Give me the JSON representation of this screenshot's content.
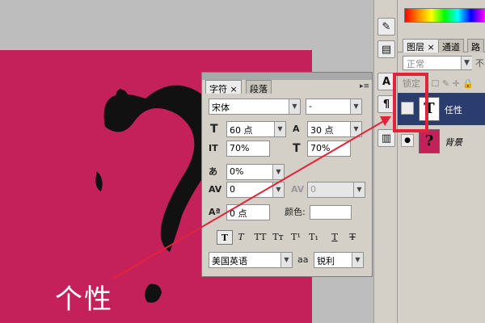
{
  "canvas": {
    "text": "个性",
    "background": "#c4215a"
  },
  "layers_panel": {
    "tabs": [
      "图层",
      "×",
      "通道",
      "路"
    ],
    "blend_mode": "正常",
    "opacity_label": "不",
    "lock_label": "锁定",
    "layers": [
      {
        "name": "任性",
        "thumb": "T",
        "selected": true
      },
      {
        "name": "背景",
        "thumb": "?",
        "selected": false
      }
    ]
  },
  "character_panel": {
    "tabs": [
      "字符",
      "×",
      "段落"
    ],
    "font_family": "宋体",
    "font_style": "-",
    "font_size": "60 点",
    "leading": "30 点",
    "vertical_scale": "70%",
    "horizontal_scale": "70%",
    "tsume": "0%",
    "kerning": "0",
    "tracking": "0",
    "baseline_shift": "0 点",
    "color_label": "颜色:",
    "language": "美国英语",
    "antialias": "锐利",
    "antialias_label": "aa",
    "icon_labels": {
      "size": "T",
      "leading": "A",
      "vscale": "IT",
      "hscale": "T",
      "tsume": "あ",
      "kerning": "AV",
      "tracking": "AV",
      "baseline": "Aª"
    },
    "style_buttons": [
      "T",
      "T",
      "TT",
      "Tт",
      "T¹",
      "T₁",
      "T",
      "T"
    ]
  },
  "toolstrip": {
    "buttons": [
      "✎",
      "▤",
      "A",
      "¶",
      "▥"
    ]
  },
  "colors": {
    "accent_red": "#e0243a",
    "canvas_pink": "#c4215a",
    "selected_layer": "#2b3c6f"
  }
}
